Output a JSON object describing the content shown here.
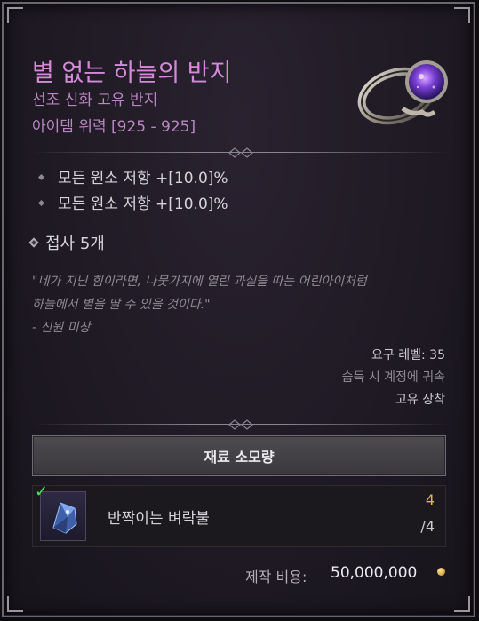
{
  "item": {
    "name": "별 없는 하늘의 반지",
    "type": "선조 신화 고유 반지",
    "power": "아이템 위력 [925 - 925]",
    "icon": "ring-icon",
    "affixes": [
      "모든 원소 저항 +[10.0]%",
      "모든 원소 저항 +[10.0]%"
    ],
    "sockets": "접사 5개",
    "flavor": [
      "\"네가 지닌 힘이라면, 나뭇가지에 열린 과실을 따는 어린아이처럼",
      "하늘에서 별을 딸 수 있을 것이다.\"",
      "- 신원 미상"
    ],
    "required_level": "요구 레벨: 35",
    "bind": "습득 시 계정에 귀속",
    "unique_equip": "고유 장착"
  },
  "materials": {
    "button_label": "재료 소모량",
    "items": [
      {
        "name": "반짝이는 벼락불",
        "have": "4",
        "need": "/4",
        "icon": "crystal-icon",
        "status_icon": "check-icon"
      }
    ]
  },
  "cost": {
    "label": "제작 비용:",
    "value": "50,000,000",
    "icon": "gold-coin-icon"
  },
  "colors": {
    "title": "#d58ad9",
    "subtitle": "#b987c2",
    "have_count": "#e3b54a",
    "check": "#4be35a"
  }
}
